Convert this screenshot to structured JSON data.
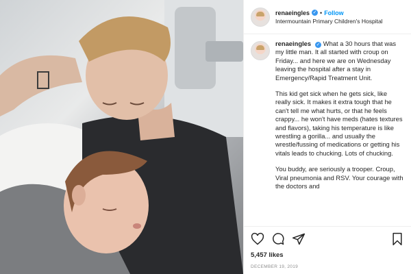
{
  "post": {
    "username": "renaeingles",
    "follow_label": "Follow",
    "separator": "•",
    "location": "Intermountain Primary Children's Hospital",
    "caption_paragraphs": [
      "What a 30 hours that was my little man. It all started with croup on Friday... and here we are on Wednesday leaving the hospital after a stay in Emergency/Rapid Treatment Unit.",
      "This kid get sick when he gets sick, like really sick. It makes it extra tough that he can't tell me what hurts, or that he feels crappy... he won't have meds (hates textures and flavors), taking his temperature is like wrestling a gorilla... and usually the wrestle/fussing of medications or getting his vitals leads to chucking. Lots of chucking.",
      "You buddy, are seriously a trooper. Croup, Viral pneumonia and RSV. Your courage with the doctors and"
    ],
    "likes": "5,457 likes",
    "date": "DECEMBER 19, 2019"
  },
  "icons": {
    "like": "heart-icon",
    "comment": "comment-icon",
    "share": "share-icon",
    "save": "bookmark-icon",
    "verified": "verified-badge-icon"
  },
  "colors": {
    "accent": "#0095f6",
    "verified": "#3897f0",
    "text": "#262626",
    "muted": "#8e8e8e"
  }
}
